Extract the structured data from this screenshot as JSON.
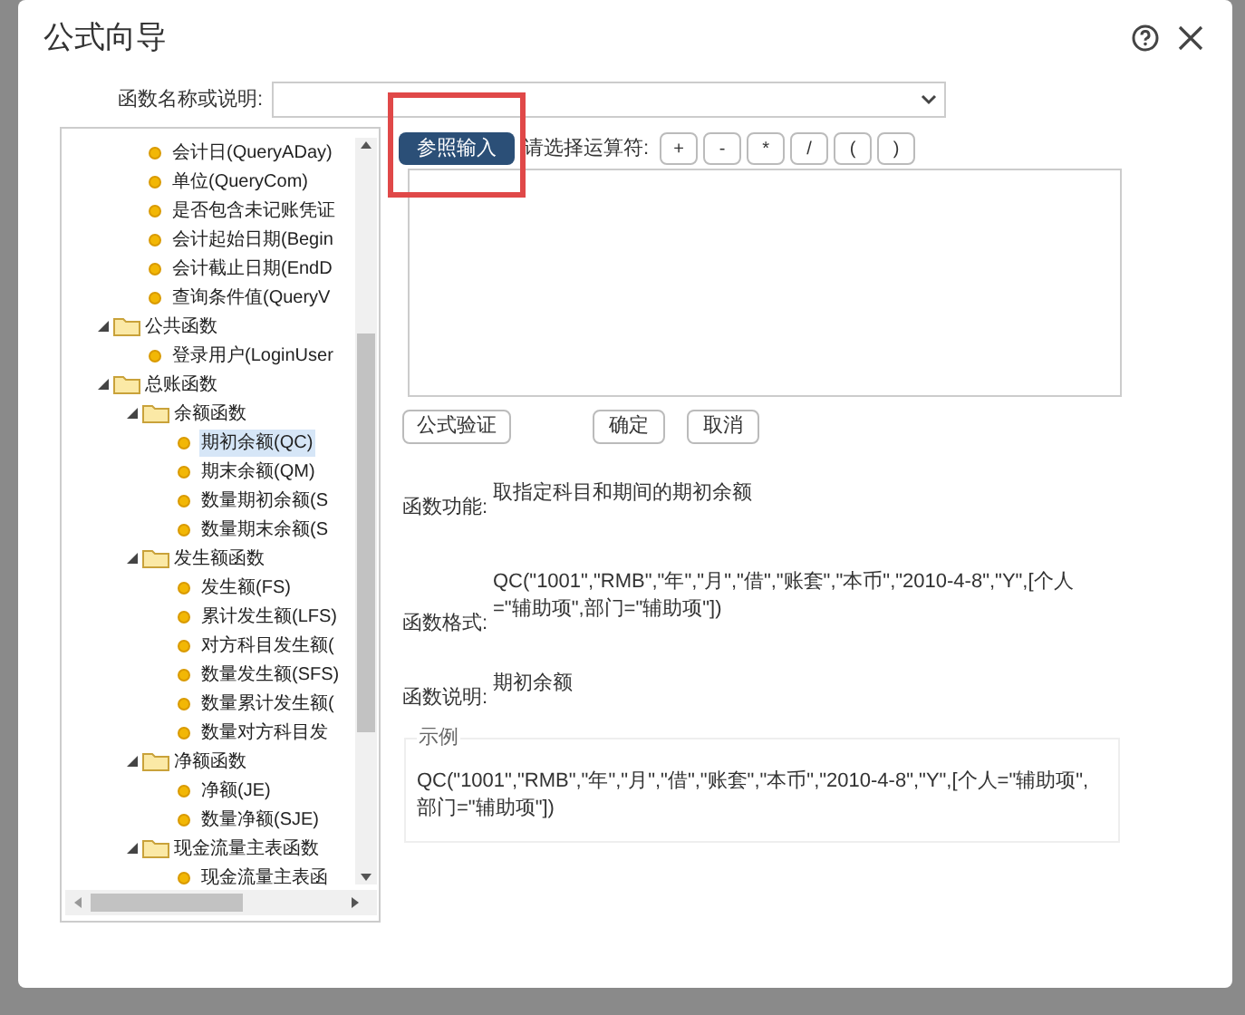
{
  "window": {
    "title": "公式向导"
  },
  "search": {
    "label": "函数名称或说明:"
  },
  "tree": {
    "continued_items": [
      {
        "label": "会计日(QueryADay)",
        "selected": false
      },
      {
        "label": "单位(QueryCom)",
        "selected": false
      },
      {
        "label": "是否包含未记账凭证",
        "selected": false
      },
      {
        "label": "会计起始日期(Begin",
        "selected": false
      },
      {
        "label": "会计截止日期(EndD",
        "selected": false
      },
      {
        "label": "查询条件值(QueryV",
        "selected": false
      }
    ],
    "nodes": [
      {
        "label": "公共函数",
        "expanded": true,
        "children": [
          {
            "label": "登录用户(LoginUser",
            "selected": false
          }
        ]
      },
      {
        "label": "总账函数",
        "expanded": true,
        "children": [
          {
            "label": "余额函数",
            "expanded": true,
            "children": [
              {
                "label": "期初余额(QC)",
                "selected": true
              },
              {
                "label": "期末余额(QM)",
                "selected": false
              },
              {
                "label": "数量期初余额(S",
                "selected": false
              },
              {
                "label": "数量期末余额(S",
                "selected": false
              }
            ]
          },
          {
            "label": "发生额函数",
            "expanded": true,
            "children": [
              {
                "label": "发生额(FS)",
                "selected": false
              },
              {
                "label": "累计发生额(LFS)",
                "selected": false
              },
              {
                "label": "对方科目发生额(",
                "selected": false
              },
              {
                "label": "数量发生额(SFS)",
                "selected": false
              },
              {
                "label": "数量累计发生额(",
                "selected": false
              },
              {
                "label": "数量对方科目发",
                "selected": false
              }
            ]
          },
          {
            "label": "净额函数",
            "expanded": true,
            "children": [
              {
                "label": "净额(JE)",
                "selected": false
              },
              {
                "label": "数量净额(SJE)",
                "selected": false
              }
            ]
          },
          {
            "label": "现金流量主表函数",
            "expanded": true,
            "children": [
              {
                "label": "现金流量主表函",
                "selected": false
              }
            ]
          }
        ]
      }
    ]
  },
  "reference_button": "参照输入",
  "operator_label": "请选择运算符:",
  "operators": [
    "+",
    "-",
    "*",
    "/",
    "(",
    ")"
  ],
  "actions": [
    {
      "label": "公式验证",
      "kind": "validate"
    },
    {
      "label": "确定",
      "kind": "ok"
    },
    {
      "label": "取消",
      "kind": "cancel"
    }
  ],
  "info": [
    {
      "label": "函数功能:",
      "value": "取指定科目和期间的期初余额"
    },
    {
      "label": "函数格式:",
      "value": "QC(\"1001\",\"RMB\",\"年\",\"月\",\"借\",\"账套\",\"本币\",\"2010-4-8\",\"Y\",[个人=\"辅助项\",部门=\"辅助项\"])"
    },
    {
      "label": "函数说明:",
      "value": "期初余额"
    }
  ],
  "example": {
    "legend": "示例",
    "text": "QC(\"1001\",\"RMB\",\"年\",\"月\",\"借\",\"账套\",\"本币\",\"2010-4-8\",\"Y\",[个人=\"辅助项\",部门=\"辅助项\"])"
  }
}
